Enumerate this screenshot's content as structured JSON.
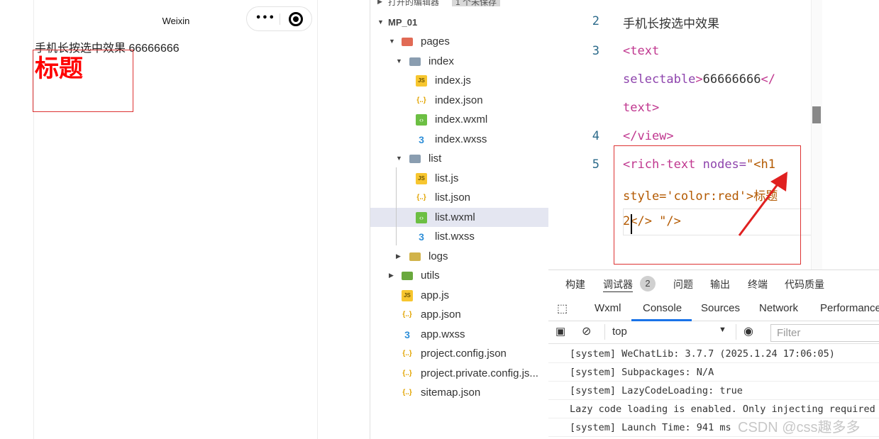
{
  "simulator": {
    "nav_title": "Weixin",
    "selectable_line": "手机长按选中效果 66666666",
    "h1_text": "标题"
  },
  "explorer": {
    "open_editors_label": "打开的编辑器",
    "unsaved_badge": "1 个未保存",
    "project": "MP_01",
    "items": [
      {
        "label": "pages",
        "icon": "folder-icon"
      },
      {
        "label": "index",
        "icon": "folder-icon"
      },
      {
        "label": "index.js",
        "icon": "js-file-icon"
      },
      {
        "label": "index.json",
        "icon": "json-file-icon"
      },
      {
        "label": "index.wxml",
        "icon": "wxml-file-icon"
      },
      {
        "label": "index.wxss",
        "icon": "wxss-file-icon"
      },
      {
        "label": "list",
        "icon": "folder-icon"
      },
      {
        "label": "list.js",
        "icon": "js-file-icon"
      },
      {
        "label": "list.json",
        "icon": "json-file-icon"
      },
      {
        "label": "list.wxml",
        "icon": "wxml-file-icon",
        "selected": true
      },
      {
        "label": "list.wxss",
        "icon": "wxss-file-icon"
      },
      {
        "label": "logs",
        "icon": "folder-icon"
      },
      {
        "label": "utils",
        "icon": "folder-icon"
      },
      {
        "label": "app.js",
        "icon": "js-file-icon"
      },
      {
        "label": "app.json",
        "icon": "json-file-icon"
      },
      {
        "label": "app.wxss",
        "icon": "wxss-file-icon"
      },
      {
        "label": "project.config.json",
        "icon": "json-file-icon"
      },
      {
        "label": "project.private.config.js...",
        "icon": "json-file-icon"
      },
      {
        "label": "sitemap.json",
        "icon": "json-file-icon"
      }
    ]
  },
  "editor": {
    "line_numbers": [
      "2",
      "3",
      "4",
      "5"
    ],
    "line2": "手机长按选中效果",
    "line3a_tag": "<text",
    "line3b_attr": "selectable",
    "line3b_gt": ">",
    "line3b_txt": "66666666",
    "line3b_close": "</",
    "line3c": "text>",
    "line4": "</view>",
    "line5a_tag": "<rich-text",
    "line5a_attr": "nodes=",
    "line5a_val": "\"<h1",
    "line5b_val": "style='color:red'>标题",
    "line5c_val": "2</> \"/>"
  },
  "bottom_panel": {
    "tabs": [
      "构建",
      "调试器",
      "问题",
      "输出",
      "终端",
      "代码质量"
    ],
    "debugger_count": "2",
    "devtools_tabs": [
      "Wxml",
      "Console",
      "Sources",
      "Network",
      "Performance"
    ],
    "active_devtools_tab": "Console",
    "context": "top",
    "filter_placeholder": "Filter",
    "console_lines": [
      "[system] WeChatLib: 3.7.7 (2025.1.24 17:06:05)",
      "[system] Subpackages: N/A",
      "[system] LazyCodeLoading: true",
      "Lazy code loading is enabled. Only injecting required",
      "[system] Launch Time: 941 ms"
    ]
  },
  "watermark": "CSDN @css趣多多"
}
